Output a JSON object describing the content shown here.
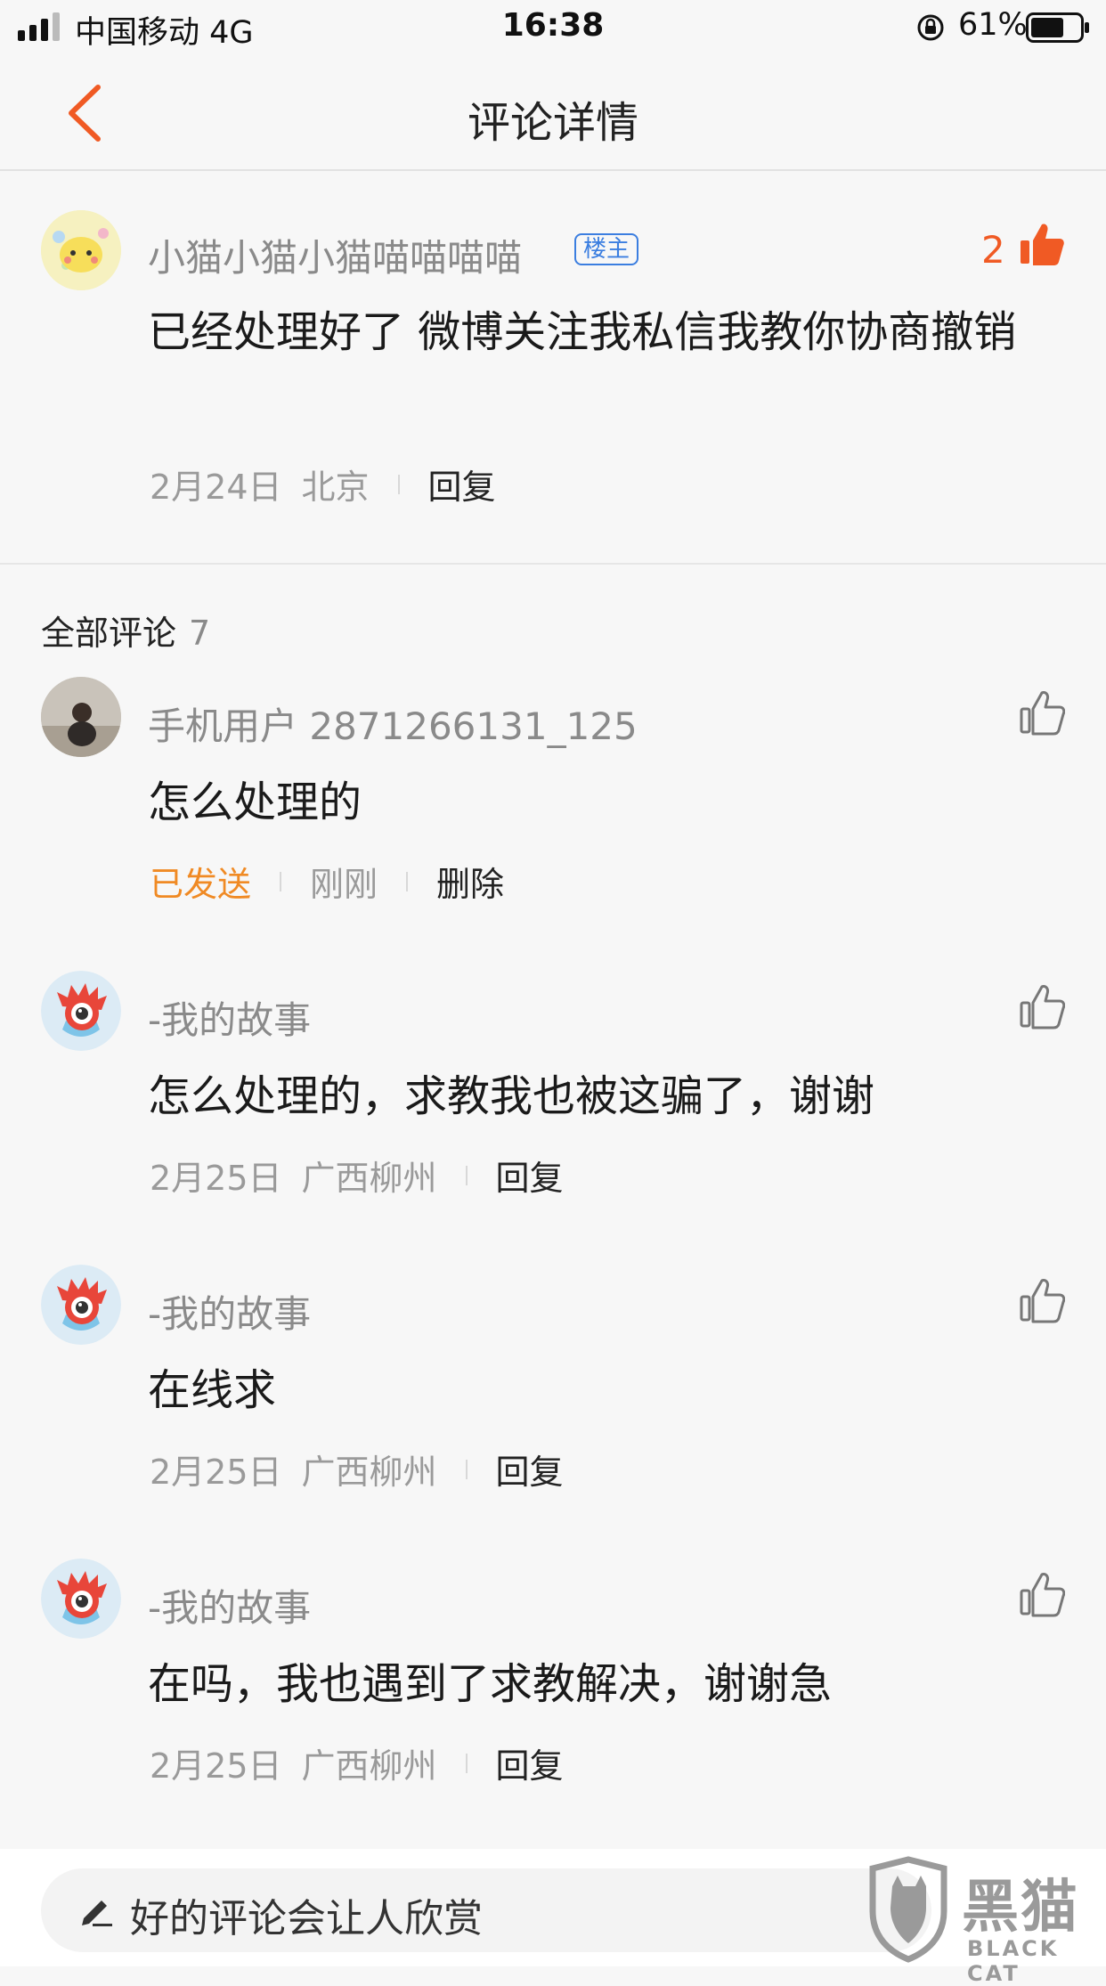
{
  "status_bar": {
    "carrier": "中国移动  4G",
    "time": "16:38",
    "battery": "61%"
  },
  "nav": {
    "title": "评论详情"
  },
  "op_comment": {
    "username": "小猫小猫小猫喵喵喵喵",
    "badge": "楼主",
    "like_count": "2",
    "text": "已经处理好了  微博关注我私信我教你协商撤销",
    "date": "2月24日",
    "location": "北京",
    "reply": "回复"
  },
  "comments_header": {
    "label": "全部评论",
    "count": "7"
  },
  "comments": [
    {
      "username": "手机用户 2871266131_125",
      "text": "怎么处理的",
      "status": "已发送",
      "time": "刚刚",
      "action": "删除"
    },
    {
      "username": "-我的故事",
      "text": "怎么处理的，求教我也被这骗了，谢谢",
      "date": "2月25日",
      "location": "广西柳州",
      "action": "回复"
    },
    {
      "username": "-我的故事",
      "text": "在线求",
      "date": "2月25日",
      "location": "广西柳州",
      "action": "回复"
    },
    {
      "username": "-我的故事",
      "text": "在吗，我也遇到了求教解决，谢谢急",
      "date": "2月25日",
      "location": "广西柳州",
      "action": "回复"
    }
  ],
  "input": {
    "placeholder": "好的评论会让人欣赏"
  },
  "watermark": {
    "zh": "黑猫",
    "en": "BLACK CAT"
  },
  "colors": {
    "accent": "#f05a24",
    "sent": "#f08a24",
    "badge": "#3b7ee0"
  }
}
